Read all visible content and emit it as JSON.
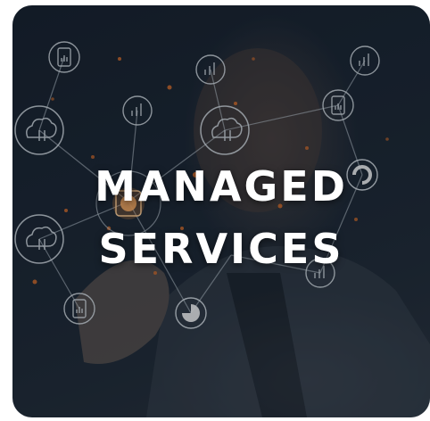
{
  "card": {
    "title_line1": "MANAGED",
    "title_line2": "SERVICES"
  },
  "colors": {
    "background_dark": "#1c2633",
    "title_text": "#ffffff",
    "network_line": "#c9d3dc",
    "glow_accent": "#e8742a"
  },
  "icons": [
    "cloud-icon",
    "bar-chart-icon",
    "document-chart-icon",
    "pie-chart-icon",
    "refresh-circle-icon",
    "chip-icon"
  ]
}
